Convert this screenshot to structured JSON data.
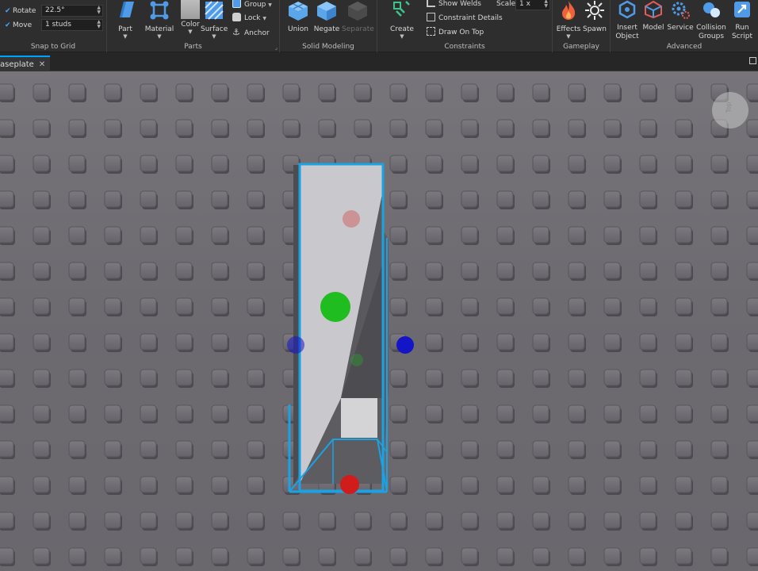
{
  "ribbon": {
    "snap_to_grid": {
      "label": "Snap to Grid",
      "rotate": {
        "label": "Rotate",
        "value": "22.5°",
        "checked": true
      },
      "move": {
        "label": "Move",
        "value": "1 studs",
        "checked": true
      }
    },
    "parts": {
      "label": "Parts",
      "part": "Part",
      "material": "Material",
      "color": "Color",
      "surface": "Surface",
      "group": "Group",
      "lock": "Lock",
      "anchor": "Anchor"
    },
    "solid_modeling": {
      "label": "Solid Modeling",
      "union": "Union",
      "negate": "Negate",
      "separate": "Separate"
    },
    "constraints": {
      "label": "Constraints",
      "create": "Create",
      "show_welds": "Show Welds",
      "constraint_details": "Constraint Details",
      "draw_on_top": "Draw On Top",
      "scale_label": "Scale",
      "scale_value": "1 x"
    },
    "gameplay": {
      "label": "Gameplay",
      "effects": "Effects",
      "spawn": "Spawn"
    },
    "advanced": {
      "label": "Advanced",
      "insert_object": [
        "Insert",
        "Object"
      ],
      "model": "Model",
      "service": "Service",
      "collision_groups": [
        "Collision",
        "Groups"
      ],
      "run_script": [
        "Run",
        "Script"
      ]
    }
  },
  "tabs": [
    {
      "label": "aseplate"
    }
  ],
  "viewcube": {
    "face": "Top"
  },
  "colors": {
    "accent": "#00a2ff",
    "selection": "#19a3e6",
    "handle_green": "#1fbd1f",
    "handle_red": "#d11c1c",
    "handle_blue": "#1515c8",
    "baseplate": "#6d6b70",
    "stud": "#5b595e"
  },
  "icons": {
    "part": "cube-icon",
    "material": "material-icon",
    "color": "color-swatch-icon",
    "surface": "surface-icon",
    "group": "group-icon",
    "lock": "lock-icon",
    "anchor": "anchor-icon",
    "union": "union-icon",
    "negate": "negate-icon",
    "separate": "separate-icon",
    "create": "constraint-icon",
    "effects": "flame-icon",
    "spawn": "spawn-icon",
    "insert_object": "insert-object-icon",
    "model": "model-icon",
    "service": "service-icon",
    "collision_groups": "collision-icon",
    "run_script": "run-script-icon"
  }
}
